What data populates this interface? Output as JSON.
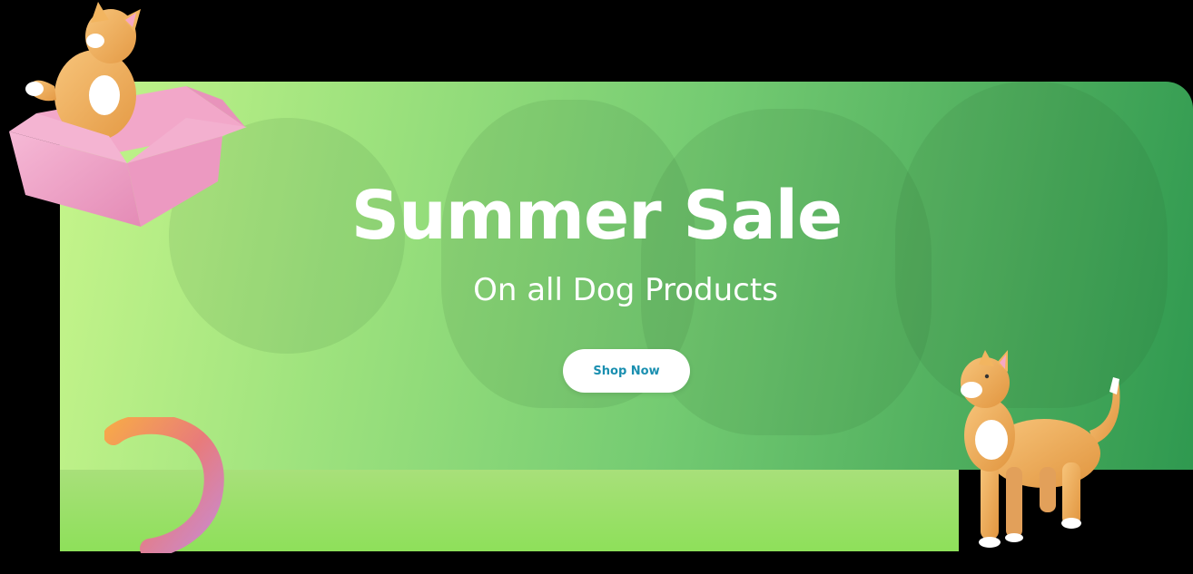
{
  "banner": {
    "title": "Summer Sale",
    "subtitle": "On all Dog Products",
    "cta_label": "Shop Now"
  },
  "colors": {
    "gradient_start": "#c6f58b",
    "gradient_end": "#2f9950",
    "cta_text": "#1a8fb0",
    "box_pink": "#f0a6c8",
    "cat_orange": "#f2b560"
  },
  "icons": [
    "cat-in-box-illustration",
    "standing-cat-illustration",
    "gradient-swirl-decoration",
    "dog-faces-background"
  ]
}
